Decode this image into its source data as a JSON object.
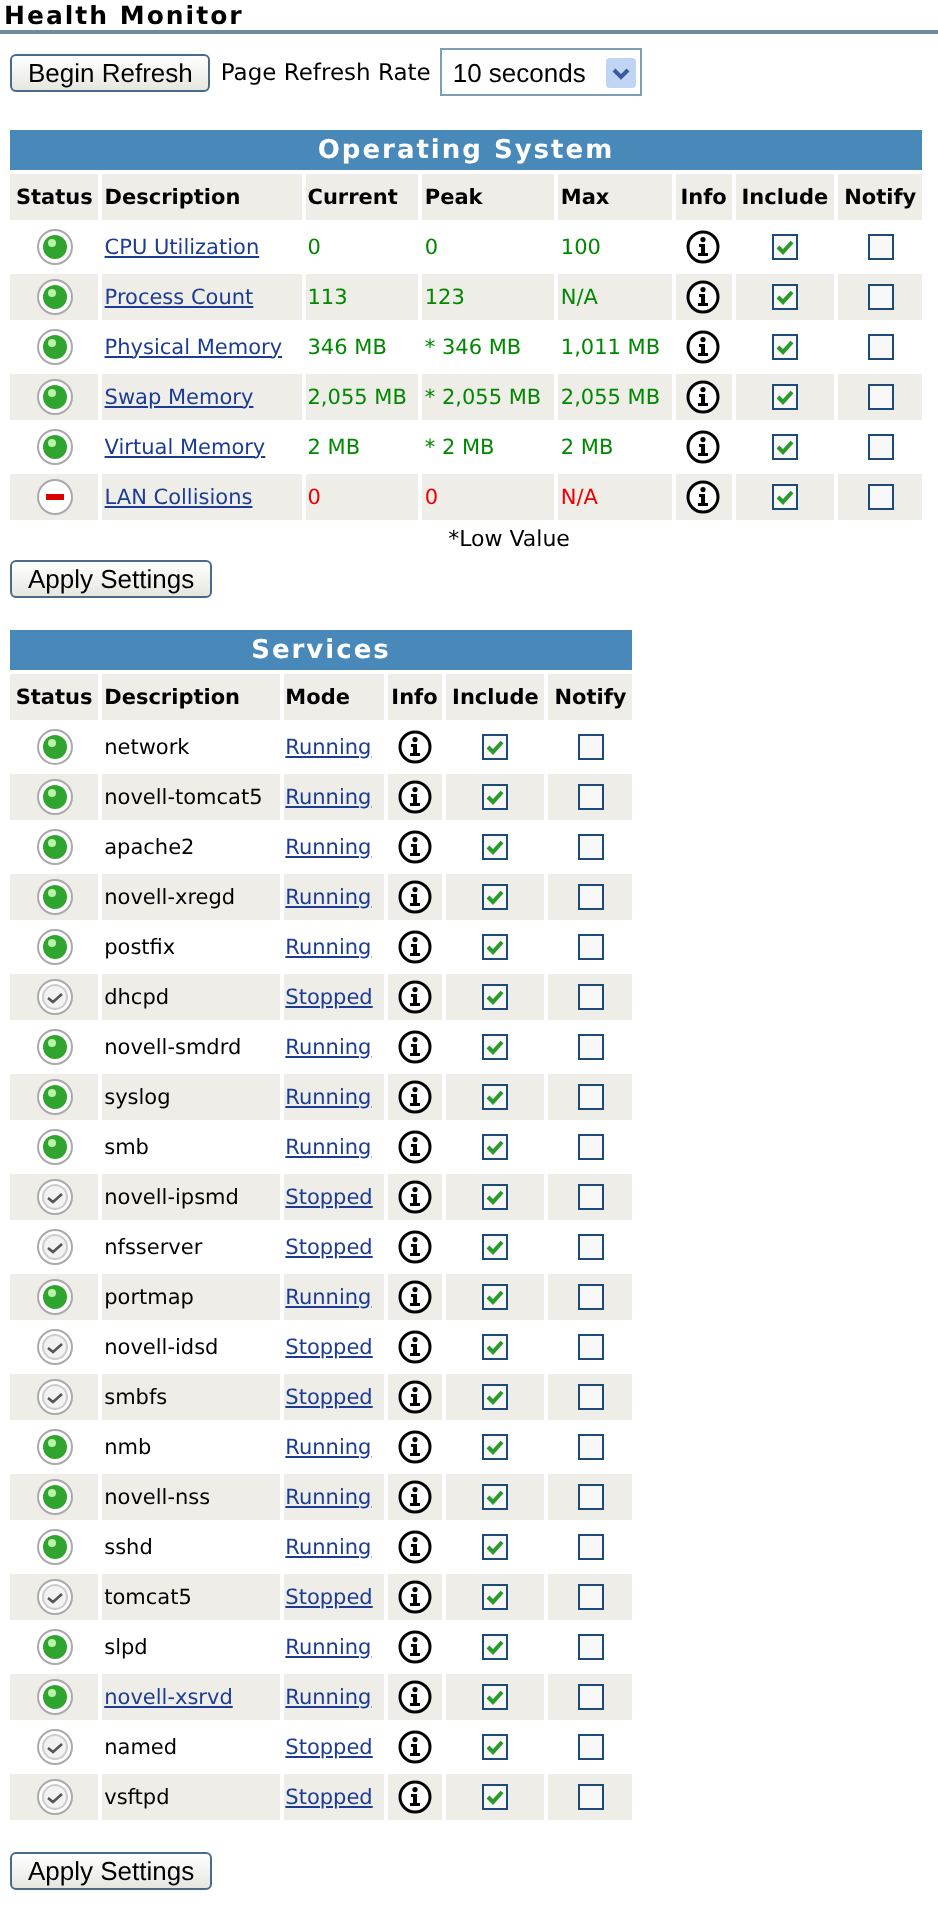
{
  "title": "Health Monitor",
  "toolbar": {
    "begin_button": "Begin Refresh",
    "rate_label": "Page Refresh Rate",
    "rate_value": "10 seconds"
  },
  "os_table": {
    "title": "Operating System",
    "columns": [
      "Status",
      "Description",
      "Current",
      "Peak",
      "Max",
      "Info",
      "Include",
      "Notify"
    ],
    "rows": [
      {
        "kind": "ok",
        "description": "CPU Utilization",
        "current": "0",
        "peak": "0",
        "max": "100",
        "include": true,
        "notify": false
      },
      {
        "kind": "ok",
        "description": "Process Count",
        "current": "113",
        "peak": "123",
        "max": "N/A",
        "include": true,
        "notify": false
      },
      {
        "kind": "ok",
        "description": "Physical Memory",
        "current": "346 MB",
        "peak": "* 346 MB",
        "max": "1,011 MB",
        "include": true,
        "notify": false
      },
      {
        "kind": "ok",
        "description": "Swap Memory",
        "current": "2,055 MB",
        "peak": "* 2,055 MB",
        "max": "2,055 MB",
        "include": true,
        "notify": false
      },
      {
        "kind": "ok",
        "description": "Virtual Memory",
        "current": "2 MB",
        "peak": "* 2 MB",
        "max": "2 MB",
        "include": true,
        "notify": false
      },
      {
        "kind": "error",
        "description": "LAN Collisions",
        "current": "0",
        "peak": "0",
        "max": "N/A",
        "include": true,
        "notify": false
      }
    ],
    "footnote": "*Low Value",
    "apply_button": "Apply Settings"
  },
  "services_table": {
    "title": "Services",
    "columns": [
      "Status",
      "Description",
      "Mode",
      "Info",
      "Include",
      "Notify"
    ],
    "rows": [
      {
        "kind": "ok",
        "description": "network",
        "link": false,
        "mode": "Running",
        "include": true,
        "notify": false
      },
      {
        "kind": "ok",
        "description": "novell-tomcat5",
        "link": false,
        "mode": "Running",
        "include": true,
        "notify": false
      },
      {
        "kind": "ok",
        "description": "apache2",
        "link": false,
        "mode": "Running",
        "include": true,
        "notify": false
      },
      {
        "kind": "ok",
        "description": "novell-xregd",
        "link": false,
        "mode": "Running",
        "include": true,
        "notify": false
      },
      {
        "kind": "ok",
        "description": "postfix",
        "link": false,
        "mode": "Running",
        "include": true,
        "notify": false
      },
      {
        "kind": "stopped",
        "description": "dhcpd",
        "link": false,
        "mode": "Stopped",
        "include": true,
        "notify": false
      },
      {
        "kind": "ok",
        "description": "novell-smdrd",
        "link": false,
        "mode": "Running",
        "include": true,
        "notify": false
      },
      {
        "kind": "ok",
        "description": "syslog",
        "link": false,
        "mode": "Running",
        "include": true,
        "notify": false
      },
      {
        "kind": "ok",
        "description": "smb",
        "link": false,
        "mode": "Running",
        "include": true,
        "notify": false
      },
      {
        "kind": "stopped",
        "description": "novell-ipsmd",
        "link": false,
        "mode": "Stopped",
        "include": true,
        "notify": false
      },
      {
        "kind": "stopped",
        "description": "nfsserver",
        "link": false,
        "mode": "Stopped",
        "include": true,
        "notify": false
      },
      {
        "kind": "ok",
        "description": "portmap",
        "link": false,
        "mode": "Running",
        "include": true,
        "notify": false
      },
      {
        "kind": "stopped",
        "description": "novell-idsd",
        "link": false,
        "mode": "Stopped",
        "include": true,
        "notify": false
      },
      {
        "kind": "stopped",
        "description": "smbfs",
        "link": false,
        "mode": "Stopped",
        "include": true,
        "notify": false
      },
      {
        "kind": "ok",
        "description": "nmb",
        "link": false,
        "mode": "Running",
        "include": true,
        "notify": false
      },
      {
        "kind": "ok",
        "description": "novell-nss",
        "link": false,
        "mode": "Running",
        "include": true,
        "notify": false
      },
      {
        "kind": "ok",
        "description": "sshd",
        "link": false,
        "mode": "Running",
        "include": true,
        "notify": false
      },
      {
        "kind": "stopped",
        "description": "tomcat5",
        "link": false,
        "mode": "Stopped",
        "include": true,
        "notify": false
      },
      {
        "kind": "ok",
        "description": "slpd",
        "link": false,
        "mode": "Running",
        "include": true,
        "notify": false
      },
      {
        "kind": "ok",
        "description": "novell-xsrvd",
        "link": true,
        "mode": "Running",
        "include": true,
        "notify": false
      },
      {
        "kind": "stopped",
        "description": "named",
        "link": false,
        "mode": "Stopped",
        "include": true,
        "notify": false
      },
      {
        "kind": "stopped",
        "description": "vsftpd",
        "link": false,
        "mode": "Stopped",
        "include": true,
        "notify": false
      }
    ],
    "apply_button": "Apply Settings"
  }
}
